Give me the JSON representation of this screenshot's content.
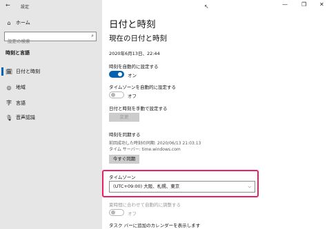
{
  "window": {
    "title": "設定",
    "back_icon": "back-arrow-icon",
    "minimize_glyph": "—",
    "maximize_glyph": "❐",
    "close_glyph": "✕"
  },
  "sidebar": {
    "home_label": "ホーム",
    "search_placeholder": "設定の検索",
    "section_title": "時刻と言語",
    "items": [
      {
        "label": "日付と時刻",
        "icon": "calendar-clock-icon",
        "glyph": "🗓",
        "active": true
      },
      {
        "label": "地域",
        "icon": "globe-icon",
        "glyph": "◎",
        "active": false
      },
      {
        "label": "言語",
        "icon": "language-icon",
        "glyph": "字",
        "active": false
      },
      {
        "label": "音声認識",
        "icon": "microphone-icon",
        "glyph": "🎙",
        "active": false
      }
    ]
  },
  "main": {
    "page_title": "日付と時刻",
    "current_heading": "現在の日付と時刻",
    "current_datetime": "2020年6月13日、22:44",
    "auto_time": {
      "label": "時刻を自動的に設定する",
      "state": "オン"
    },
    "auto_tz": {
      "label": "タイムゾーンを自動的に設定する",
      "state": "オフ"
    },
    "manual": {
      "label": "日付と時刻を手動で設定する",
      "button": "変更"
    },
    "sync": {
      "heading": "時刻を同期する",
      "last_sync": "前回成功した時刻の同期: 2020/06/13 21:03:13",
      "server": "タイム サーバー: time.windows.com",
      "button": "今すぐ同期"
    },
    "timezone": {
      "label": "タイムゾーン",
      "value": "(UTC+09:00) 大阪、札幌、東京"
    },
    "dst": {
      "label": "夏時間に合わせて自動的に調整する",
      "state": "オフ"
    },
    "taskbar_calendar": "タスク バーに追加のカレンダーを表示します"
  },
  "colors": {
    "accent": "#0063b1",
    "highlight": "#e91e63",
    "sidebar_bg": "#e6e6e6"
  }
}
